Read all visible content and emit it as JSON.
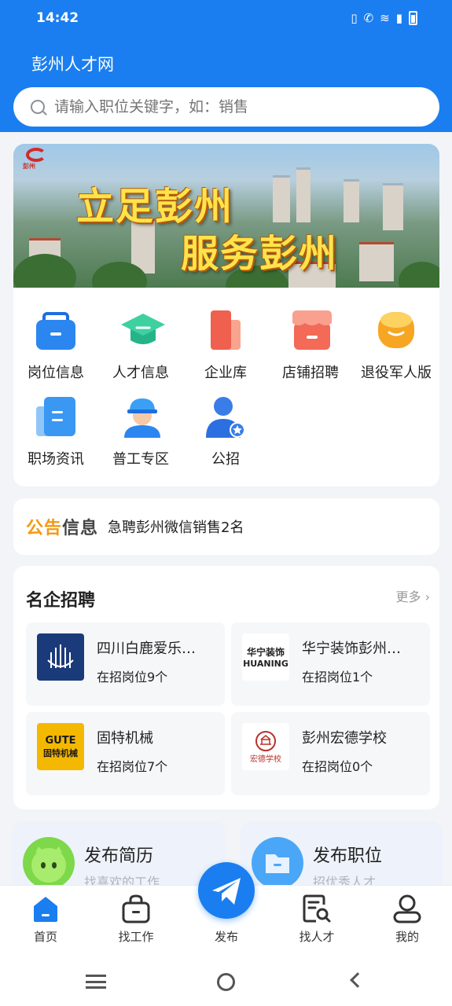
{
  "status_bar": {
    "time": "14:42"
  },
  "header": {
    "title": "彭州人才网",
    "search_placeholder": "请输入职位关键字，如：销售"
  },
  "banner": {
    "slogan_line1": "立足彭州",
    "slogan_line2": "服务彭州"
  },
  "quick_menu": [
    {
      "label": "岗位信息",
      "icon": "briefcase-icon"
    },
    {
      "label": "人才信息",
      "icon": "graduation-cap-icon"
    },
    {
      "label": "企业库",
      "icon": "company-card-icon"
    },
    {
      "label": "店铺招聘",
      "icon": "shop-icon"
    },
    {
      "label": "退役军人版",
      "icon": "veteran-icon"
    },
    {
      "label": "职场资讯",
      "icon": "news-icon"
    },
    {
      "label": "普工专区",
      "icon": "worker-helmet-icon"
    },
    {
      "label": "公招",
      "icon": "person-star-icon"
    }
  ],
  "notice": {
    "logo_a": "公告",
    "logo_b": "信息",
    "text": "急聘彭州微信销售2名"
  },
  "famous": {
    "title": "名企招聘",
    "more": "更多",
    "companies": [
      {
        "name": "四川白鹿爱乐…",
        "jobs": "在招岗位9个"
      },
      {
        "name": "华宁装饰彭州…",
        "jobs": "在招岗位1个",
        "logo_text": "华宁装饰",
        "logo_sub": "HUANING"
      },
      {
        "name": "固特机械",
        "jobs": "在招岗位7个",
        "logo_text": "GUTE",
        "logo_sub": "固特机械"
      },
      {
        "name": "彭州宏德学校",
        "jobs": "在招岗位0个",
        "logo_text": "宏德学校"
      }
    ]
  },
  "actions": [
    {
      "title": "发布简历",
      "subtitle": "找喜欢的工作"
    },
    {
      "title": "发布职位",
      "subtitle": "招优秀人才"
    }
  ],
  "tabbar": [
    {
      "label": "首页"
    },
    {
      "label": "找工作"
    },
    {
      "label": "发布"
    },
    {
      "label": "找人才"
    },
    {
      "label": "我的"
    }
  ],
  "colors": {
    "primary": "#1a7ef0",
    "notice_orange": "#f39a13"
  }
}
